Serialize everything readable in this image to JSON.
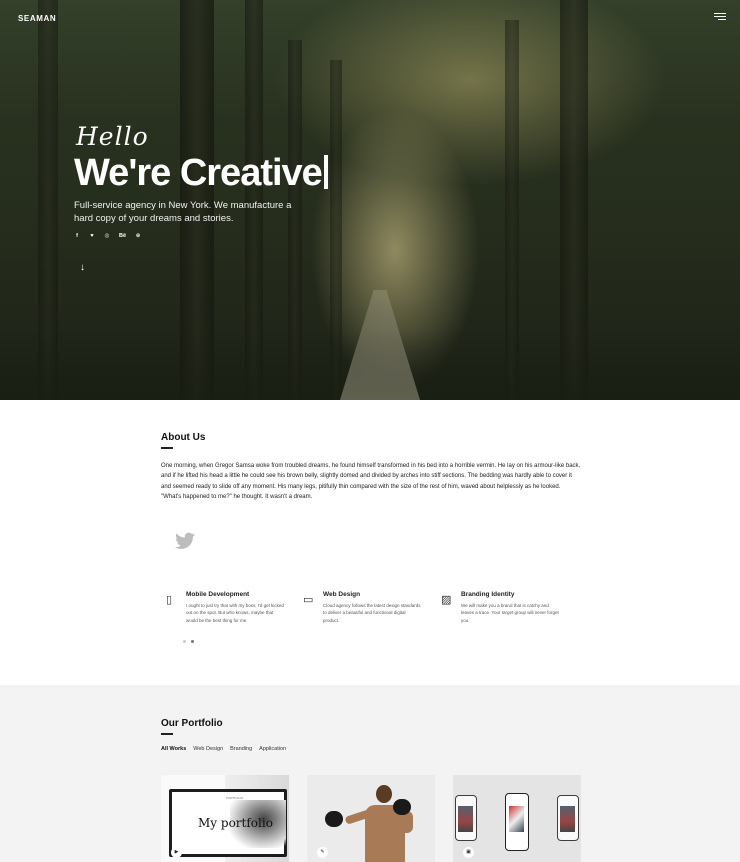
{
  "header": {
    "logo": "SEAMAN",
    "menu_icon": "hamburger-icon"
  },
  "hero": {
    "greeting": "Hello",
    "headline": "We're Creative",
    "subtitle": "Full-service agency in New York. We manufacture a hard copy of your dreams and stories.",
    "socials": [
      {
        "label": "f",
        "icon": "facebook-icon"
      },
      {
        "label": "♥",
        "icon": "twitter-icon"
      },
      {
        "label": "◎",
        "icon": "instagram-icon"
      },
      {
        "label": "Bē",
        "icon": "behance-icon"
      },
      {
        "label": "⊛",
        "icon": "dribbble-icon"
      }
    ],
    "scroll_icon": "arrow-down-icon",
    "scroll_glyph": "↓"
  },
  "about": {
    "title": "About Us",
    "text": "One morning, when Gregor Samsa woke from troubled dreams, he found himself transformed in his bed into a horrible vermin. He lay on his armour-like back, and if he lifted his head a little he could see his brown belly, slightly domed and divided by arches into stiff sections. The bedding was hardly able to cover it and seemed ready to slide off any moment. His many legs, pitifully thin compared with the size of the rest of him, waved about helplessly as he looked. \"What's happened to me?\" he thought. It wasn't a dream.",
    "tweet_icon": "twitter-icon",
    "services": [
      {
        "icon": "mobile-icon",
        "glyph": "▯",
        "title": "Mobile Development",
        "desc": "I ought to just try that with my boss; I'd get kicked out on the spot. But who knows, maybe that would be the best thing for me."
      },
      {
        "icon": "monitor-icon",
        "glyph": "▭",
        "title": "Web Design",
        "desc": "Cloud agency follows the latest design standards to deliver a beautiful and functional digital product."
      },
      {
        "icon": "image-icon",
        "glyph": "▨",
        "title": "Branding Identity",
        "desc": "We will make you a brand that is catchy and leaves a trace. Your target group will never forget you."
      }
    ]
  },
  "portfolio": {
    "title": "Our Portfolio",
    "filters": [
      "All Works",
      "Web Design",
      "Branding",
      "Application"
    ],
    "active_filter": "All Works",
    "cards": [
      {
        "title": "My portfolio",
        "small_label": "PORTFOLIO",
        "icon": "play-icon",
        "glyph": "▶"
      },
      {
        "icon": "edit-icon",
        "glyph": "✎"
      },
      {
        "icon": "image-icon",
        "glyph": "▣"
      }
    ]
  }
}
